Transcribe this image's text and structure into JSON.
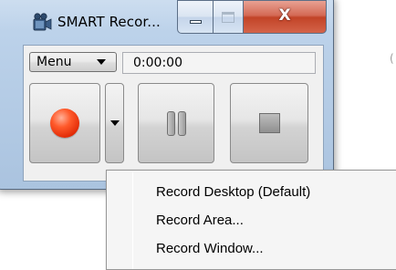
{
  "window": {
    "title": "SMART Recor...",
    "caption": {
      "minimize_icon": "minimize-icon",
      "maximize_icon": "maximize-icon",
      "close_label": "X"
    }
  },
  "toolbar": {
    "menu_label": "Menu",
    "menu_arrow_icon": "chevron-down-icon",
    "elapsed_time": "0:00:00"
  },
  "controls": {
    "record_icon": "record-icon",
    "record_options_icon": "chevron-down-icon",
    "pause_icon": "pause-icon",
    "stop_icon": "stop-icon",
    "record_color": "#ff4a1c"
  },
  "record_menu": {
    "items": [
      {
        "label": "Record Desktop (Default)"
      },
      {
        "label": "Record Area..."
      },
      {
        "label": "Record Window..."
      }
    ]
  }
}
